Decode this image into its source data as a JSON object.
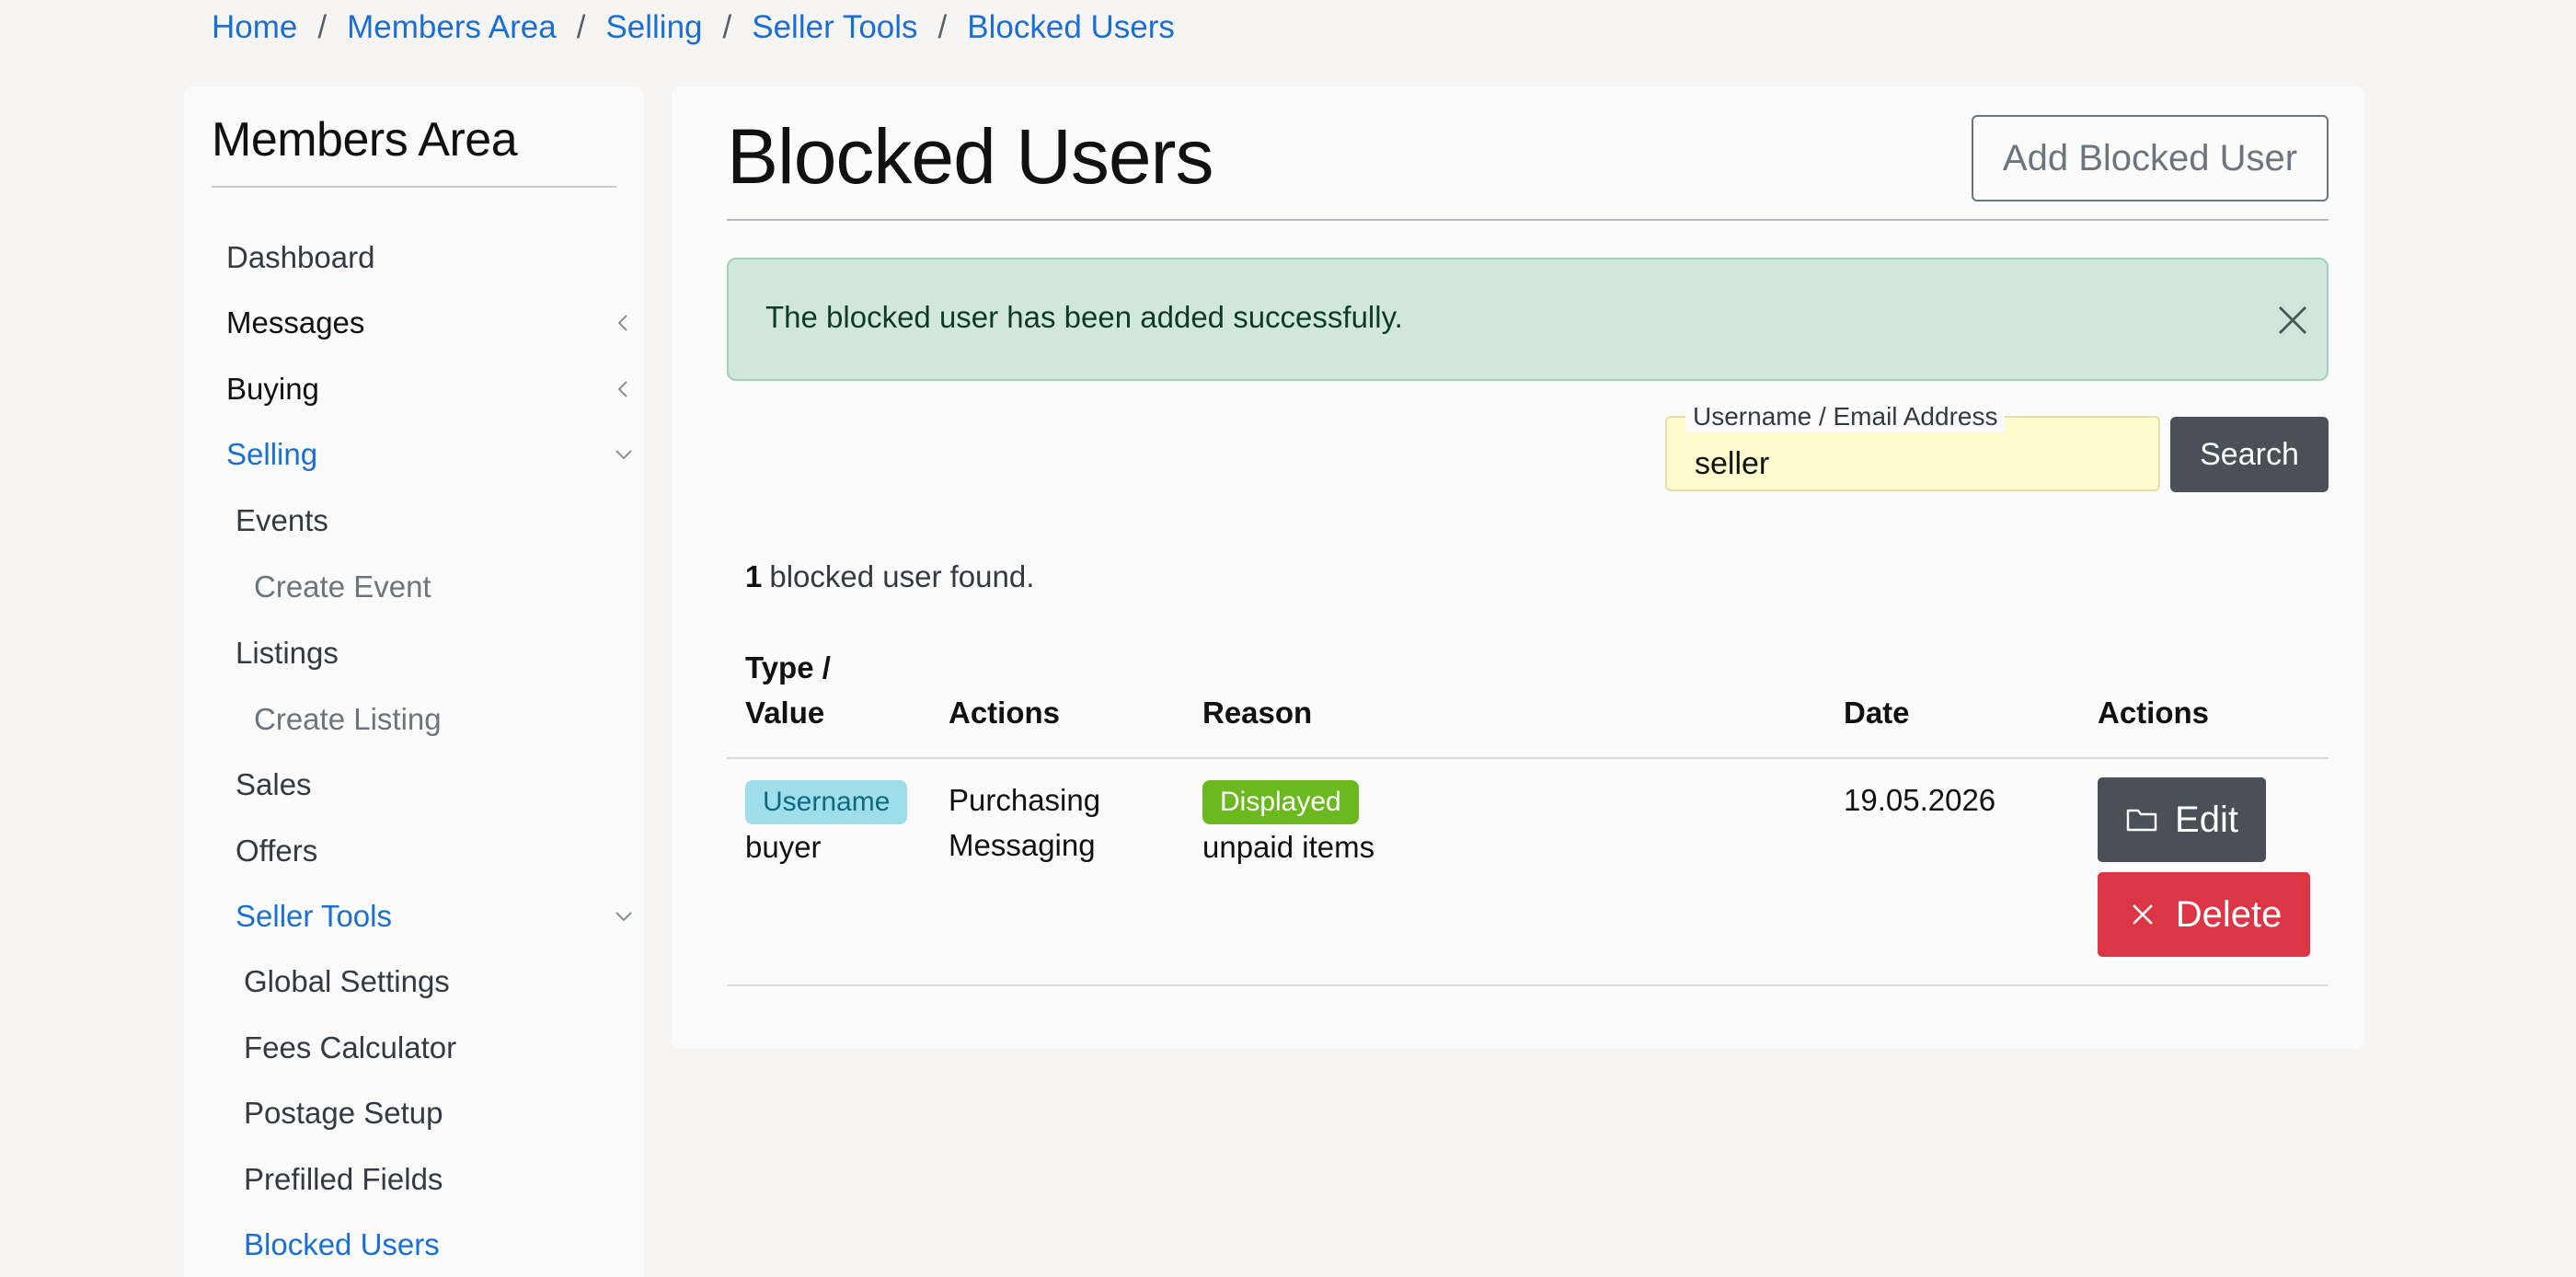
{
  "breadcrumb": [
    "Home",
    "Members Area",
    "Selling",
    "Seller Tools",
    "Blocked Users"
  ],
  "breadcrumb_separator": "/",
  "sidebar": {
    "title": "Members Area",
    "items": [
      {
        "label": "Dashboard"
      },
      {
        "label": "Messages",
        "chevron": "left"
      },
      {
        "label": "Buying",
        "chevron": "left"
      },
      {
        "label": "Selling",
        "chevron": "down",
        "active": true
      },
      {
        "label": "Events"
      },
      {
        "label": "Create Event"
      },
      {
        "label": "Listings"
      },
      {
        "label": "Create Listing"
      },
      {
        "label": "Sales"
      },
      {
        "label": "Offers"
      },
      {
        "label": "Seller Tools",
        "chevron": "down",
        "active": true
      },
      {
        "label": "Global Settings"
      },
      {
        "label": "Fees Calculator"
      },
      {
        "label": "Postage Setup"
      },
      {
        "label": "Prefilled Fields"
      },
      {
        "label": "Blocked Users",
        "active": true
      }
    ]
  },
  "main": {
    "title": "Blocked Users",
    "add_button": "Add Blocked User",
    "alert": {
      "text": "The blocked user has been added successfully.",
      "close_icon": "close-icon"
    },
    "search": {
      "label": "Username / Email Address",
      "value": "seller",
      "button": "Search"
    },
    "result_count": "1",
    "result_text": "blocked user found.",
    "table": {
      "columns": [
        "Type /",
        "Value",
        "Actions",
        "Reason",
        "Date",
        "Actions"
      ],
      "rows": [
        {
          "type": "Username",
          "value": "buyer",
          "actions": [
            "Purchasing",
            "Messaging"
          ],
          "reason_badge": "Displayed",
          "reason": "unpaid items",
          "date": "19.05.2026",
          "edit": "Edit",
          "delete": "Delete"
        }
      ]
    }
  },
  "colors": {
    "link": "#1a6fd6",
    "alert_bg": "#d1e7dd",
    "search_bg": "#fdfbcd",
    "dark_button": "#495057",
    "danger": "#dc3545",
    "badge_info": "#9eddea",
    "badge_success": "#6bb81f"
  }
}
